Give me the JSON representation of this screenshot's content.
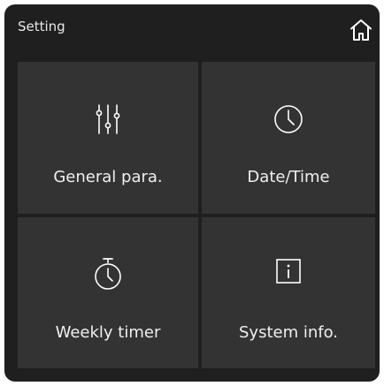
{
  "header": {
    "title": "Setting",
    "home_icon": "home-icon"
  },
  "tiles": [
    {
      "label": "General para.",
      "icon": "sliders-icon"
    },
    {
      "label": "Date/Time",
      "icon": "clock-icon"
    },
    {
      "label": "Weekly timer",
      "icon": "stopwatch-icon"
    },
    {
      "label": "System info.",
      "icon": "info-icon"
    }
  ],
  "colors": {
    "background": "#1f1f1f",
    "tile": "#333333",
    "text": "#efefef"
  }
}
